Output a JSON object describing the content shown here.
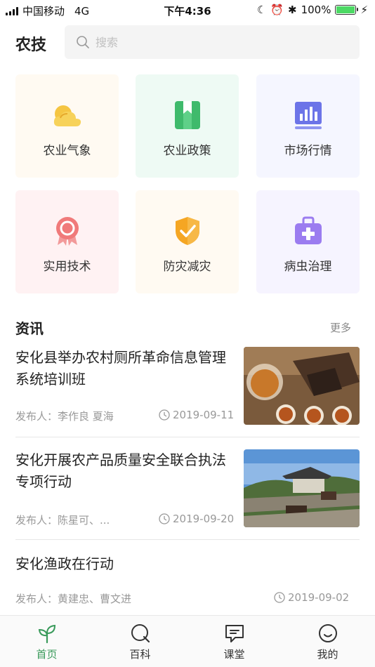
{
  "status_bar": {
    "carrier": "中国移动",
    "network": "4G",
    "time": "下午4:36",
    "battery": "100%"
  },
  "header": {
    "title": "农技",
    "search_placeholder": "搜索"
  },
  "categories": [
    {
      "label": "农业气象",
      "icon": "weather-cloud-icon",
      "bg": "#fffaf2",
      "color": "#f5c542"
    },
    {
      "label": "农业政策",
      "icon": "policy-book-icon",
      "bg": "#eefaf4",
      "color": "#3fba6c"
    },
    {
      "label": "市场行情",
      "icon": "market-chart-icon",
      "bg": "#f5f6ff",
      "color": "#6c74e8"
    },
    {
      "label": "实用技术",
      "icon": "tech-award-icon",
      "bg": "#fff2f3",
      "color": "#f07a7a"
    },
    {
      "label": "防灾减灾",
      "icon": "shield-check-icon",
      "bg": "#fffaf2",
      "color": "#f5a623"
    },
    {
      "label": "病虫治理",
      "icon": "medical-kit-icon",
      "bg": "#f6f4ff",
      "color": "#9b7cf0"
    }
  ],
  "news": {
    "title": "资讯",
    "more": "更多",
    "articles": [
      {
        "headline": "安化县举办农村厕所革命信息管理系统培训班",
        "publisher": "发布人：李作良 夏海",
        "date": "2019-09-11",
        "thumb": "tea-photo"
      },
      {
        "headline": "安化开展农产品质量安全联合执法专项行动",
        "publisher": "发布人：陈星可、...",
        "date": "2019-09-20",
        "thumb": "horse-bridge-photo"
      },
      {
        "headline": "安化渔政在行动",
        "publisher": "发布人：黄建忠、曹文进",
        "date": "2019-09-02"
      }
    ]
  },
  "tabs": [
    {
      "label": "首页",
      "icon": "sprout-icon",
      "active": true
    },
    {
      "label": "百科",
      "icon": "search-q-icon",
      "active": false
    },
    {
      "label": "课堂",
      "icon": "chat-class-icon",
      "active": false
    },
    {
      "label": "我的",
      "icon": "smile-profile-icon",
      "active": false
    }
  ],
  "colors": {
    "accent": "#3a9a5b"
  }
}
